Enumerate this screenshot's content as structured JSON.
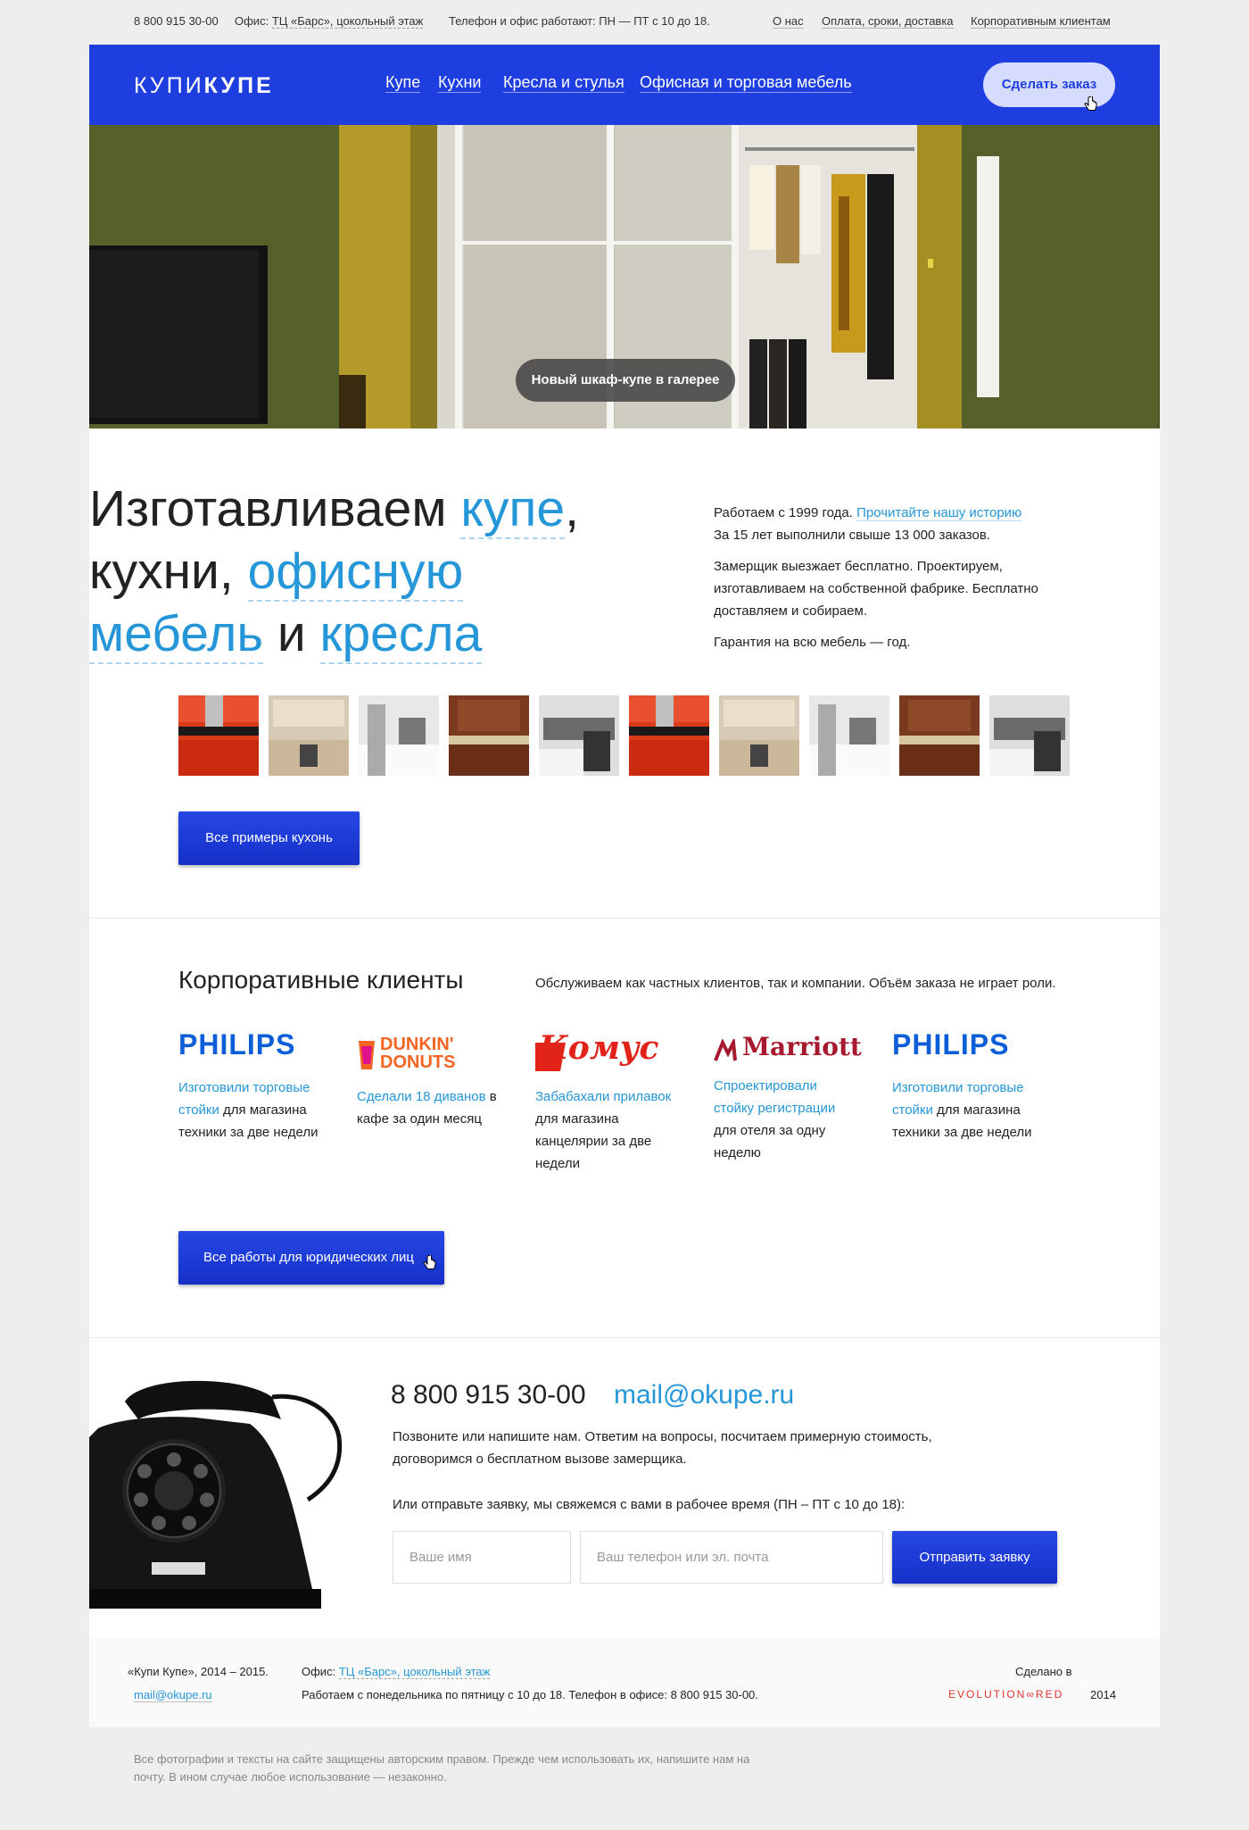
{
  "topbar": {
    "phone": "8 800 915 30-00",
    "office_label": "Офис:",
    "office_link": "ТЦ «Барс», цокольный этаж",
    "hours": "Телефон и офис работают: ПН — ПТ с 10 до 18.",
    "links": [
      "О нас",
      "Оплата, сроки, доставка",
      "Корпоративным клиентам"
    ]
  },
  "header": {
    "logo_light": "КУПИ",
    "logo_bold": "КУПЕ",
    "nav": [
      "Купе",
      "Кухни",
      "Кресла и стулья",
      "Офисная и торговая мебель"
    ],
    "order_button": "Сделать заказ"
  },
  "hero": {
    "badge": "Новый шкаф-купе в галерее"
  },
  "intro": {
    "heading_parts": [
      "Изготавливаем ",
      "купе",
      ",",
      " кухни, ",
      "офисную мебель",
      " и ",
      "кресла"
    ],
    "since": "Работаем с 1999 года.",
    "history_link": "Прочитайте нашу историю",
    "orders": "За 15 лет выполнили свыше 13 000 заказов.",
    "measure": "Замерщик выезжает бесплатно. Проектируем, изготавливаем на собственной фабрике. Бесплатно доставляем и собираем.",
    "warranty": "Гарантия на всю мебель — год.",
    "all_kitchens_button": "Все примеры кухонь"
  },
  "corporate": {
    "title": "Корпоративные клиенты",
    "subtitle": "Обслуживаем как частных клиентов, так и компании. Объём заказа не играет роли.",
    "clients": [
      {
        "logo": "PHILIPS",
        "link": "Изготовили торговые стойки",
        "text": "для магазина техники за две недели"
      },
      {
        "logo": "DUNKIN' DONUTS",
        "link": "Сделали 18 диванов",
        "text": "в кафе за один месяц"
      },
      {
        "logo": "Комус",
        "link": "Забабахали прилавок",
        "text": "для магазина канцелярии за две недели"
      },
      {
        "logo": "Marriott",
        "link": "Спроектировали стойку регистрации",
        "text": "для отеля за одну неделю"
      },
      {
        "logo": "PHILIPS",
        "link": "Изготовили торговые стойки",
        "text": "для магазина техники за две недели"
      }
    ],
    "all_works_button": "Все работы для юридических лиц"
  },
  "contact": {
    "phone": "8 800 915 30-00",
    "email": "mail@okupe.ru",
    "text": "Позвоните или напишите нам. Ответим на вопросы, посчитаем примерную стоимость, договоримся о бесплатном вызове замерщика.",
    "form_label": "Или отправьте заявку, мы свяжемся с вами в рабочее время (ПН – ПТ с 10 до 18):",
    "name_placeholder": "Ваше имя",
    "contact_placeholder": "Ваш телефон или эл. почта",
    "submit_button": "Отправить заявку"
  },
  "footer": {
    "copyright": "«Купи Купе», 2014 – 2015.",
    "email": "mail@okupe.ru",
    "office_label": "Офис:",
    "office_link": "ТЦ «Барс», цокольный этаж",
    "schedule": "Работаем с понедельника по пятницу с 10 до 18. Телефон в офисе: 8 800 915 30-00.",
    "made_in": "Сделано в",
    "agency": "EVOLUTION∞RED",
    "year": "2014"
  },
  "legal": "Все фотографии и тексты на сайте защищены авторским правом. Прежде чем использовать их, напишите нам на почту. В ином случае любое использование — незаконно.",
  "colors": {
    "brand_blue": "#1e3ee0",
    "link_blue": "#2596d8",
    "agency_red": "#e2332f"
  }
}
